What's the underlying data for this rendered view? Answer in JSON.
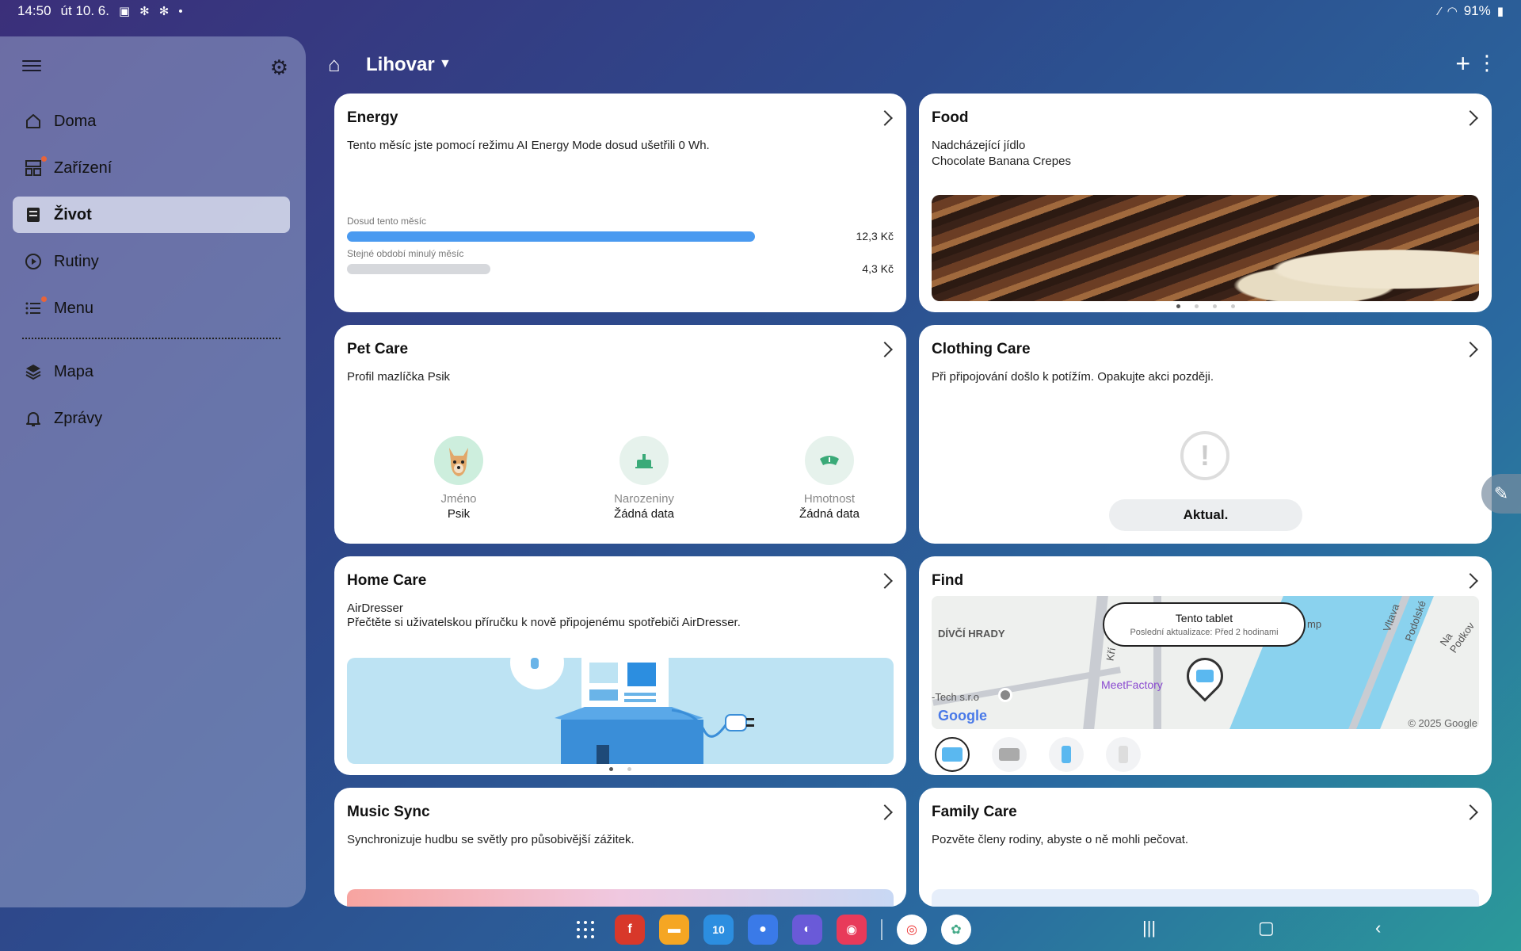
{
  "status": {
    "time": "14:50",
    "date": "út 10. 6.",
    "battery": "91%"
  },
  "sidebar": {
    "items": [
      {
        "label": "Doma",
        "icon": "home-icon"
      },
      {
        "label": "Zařízení",
        "icon": "devices-icon"
      },
      {
        "label": "Život",
        "icon": "life-icon"
      },
      {
        "label": "Rutiny",
        "icon": "routines-icon"
      },
      {
        "label": "Menu",
        "icon": "menu-list-icon"
      },
      {
        "label": "Mapa",
        "icon": "map-icon"
      },
      {
        "label": "Zprávy",
        "icon": "bell-icon"
      }
    ]
  },
  "header": {
    "title": "Lihovar"
  },
  "cards": {
    "energy": {
      "title": "Energy",
      "text": "Tento měsíc jste pomocí režimu AI Energy Mode dosud ušetřili 0 Wh.",
      "bar1_label": "Dosud tento měsíc",
      "bar1_value": "12,3 Kč",
      "bar1_fraction": 0.75,
      "bar2_label": "Stejné období minulý měsíc",
      "bar2_value": "4,3 Kč",
      "bar2_fraction": 0.26
    },
    "food": {
      "title": "Food",
      "line1": "Nadcházející jídlo",
      "line2": "Chocolate Banana Crepes"
    },
    "pet": {
      "title": "Pet Care",
      "text": "Profil mazlíčka Psik",
      "col1_label": "Jméno",
      "col1_value": "Psik",
      "col2_label": "Narozeniny",
      "col2_value": "Žádná data",
      "col3_label": "Hmotnost",
      "col3_value": "Žádná data"
    },
    "clothing": {
      "title": "Clothing Care",
      "text": "Při připojování došlo k potížím. Opakujte akci později.",
      "button": "Aktual."
    },
    "home": {
      "title": "Home Care",
      "line1": "AirDresser",
      "line2": "Přečtěte si uživatelskou příručku k nově připojenému spotřebiči AirDresser."
    },
    "find": {
      "title": "Find",
      "tooltip_title": "Tento tablet",
      "tooltip_sub": "Poslední aktualizace: Před 2 hodinami",
      "map_label1": "DÍVČÍ HRADY",
      "map_label2": "MeetFactory",
      "map_label3": "-Tech s.r.o",
      "map_label4": "Vltava",
      "map_label5": "Podolské",
      "map_label6": "Na Podkov",
      "map_label7": "mp",
      "map_label8": "Kří",
      "google": "Google",
      "copyright": "© 2025 Google"
    },
    "music": {
      "title": "Music Sync",
      "text": "Synchronizuje hudbu se světly pro působivější zážitek."
    },
    "family": {
      "title": "Family Care",
      "text": "Pozvěte členy rodiny, abyste o ně mohli pečovat."
    }
  },
  "taskbar": {
    "calendar_day": "10"
  },
  "colors": {
    "accent": "#4a9af0",
    "badge": "#e8643a"
  }
}
